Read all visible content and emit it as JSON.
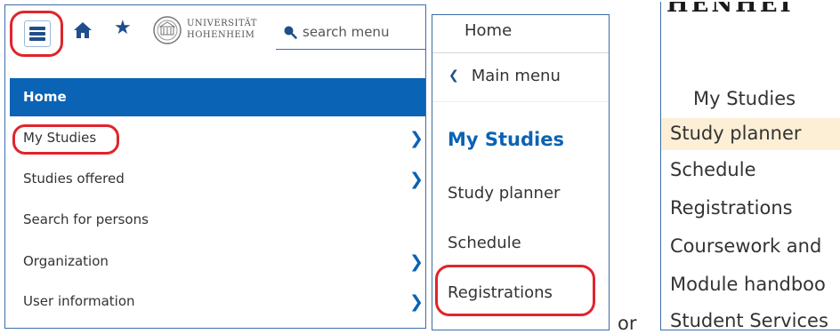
{
  "panel1": {
    "logo_line1": "UNIVERSITÄT",
    "logo_line2": "HOHENHEIM",
    "search_placeholder": "search menu",
    "home_label": "Home",
    "items": [
      {
        "label": "My Studies",
        "has_submenu": true
      },
      {
        "label": "Studies offered",
        "has_submenu": true
      },
      {
        "label": "Search for persons",
        "has_submenu": false
      },
      {
        "label": "Organization",
        "has_submenu": true
      },
      {
        "label": "User information",
        "has_submenu": true
      }
    ]
  },
  "panel2": {
    "home_label": "Home",
    "main_menu_label": "Main menu",
    "section_title": "My Studies",
    "items": [
      "Study planner",
      "Schedule",
      "Registrations"
    ]
  },
  "or_label": "or",
  "panel3": {
    "logo_partial": "HENHEI",
    "section_title": "My Studies",
    "items": [
      "Study planner",
      "Schedule",
      "Registrations",
      "Coursework and",
      "Module handboo",
      "Student Services"
    ]
  },
  "colors": {
    "accent_blue": "#0a63b4",
    "highlight_ring": "#e0242b",
    "selected_row": "#fdefd6"
  }
}
